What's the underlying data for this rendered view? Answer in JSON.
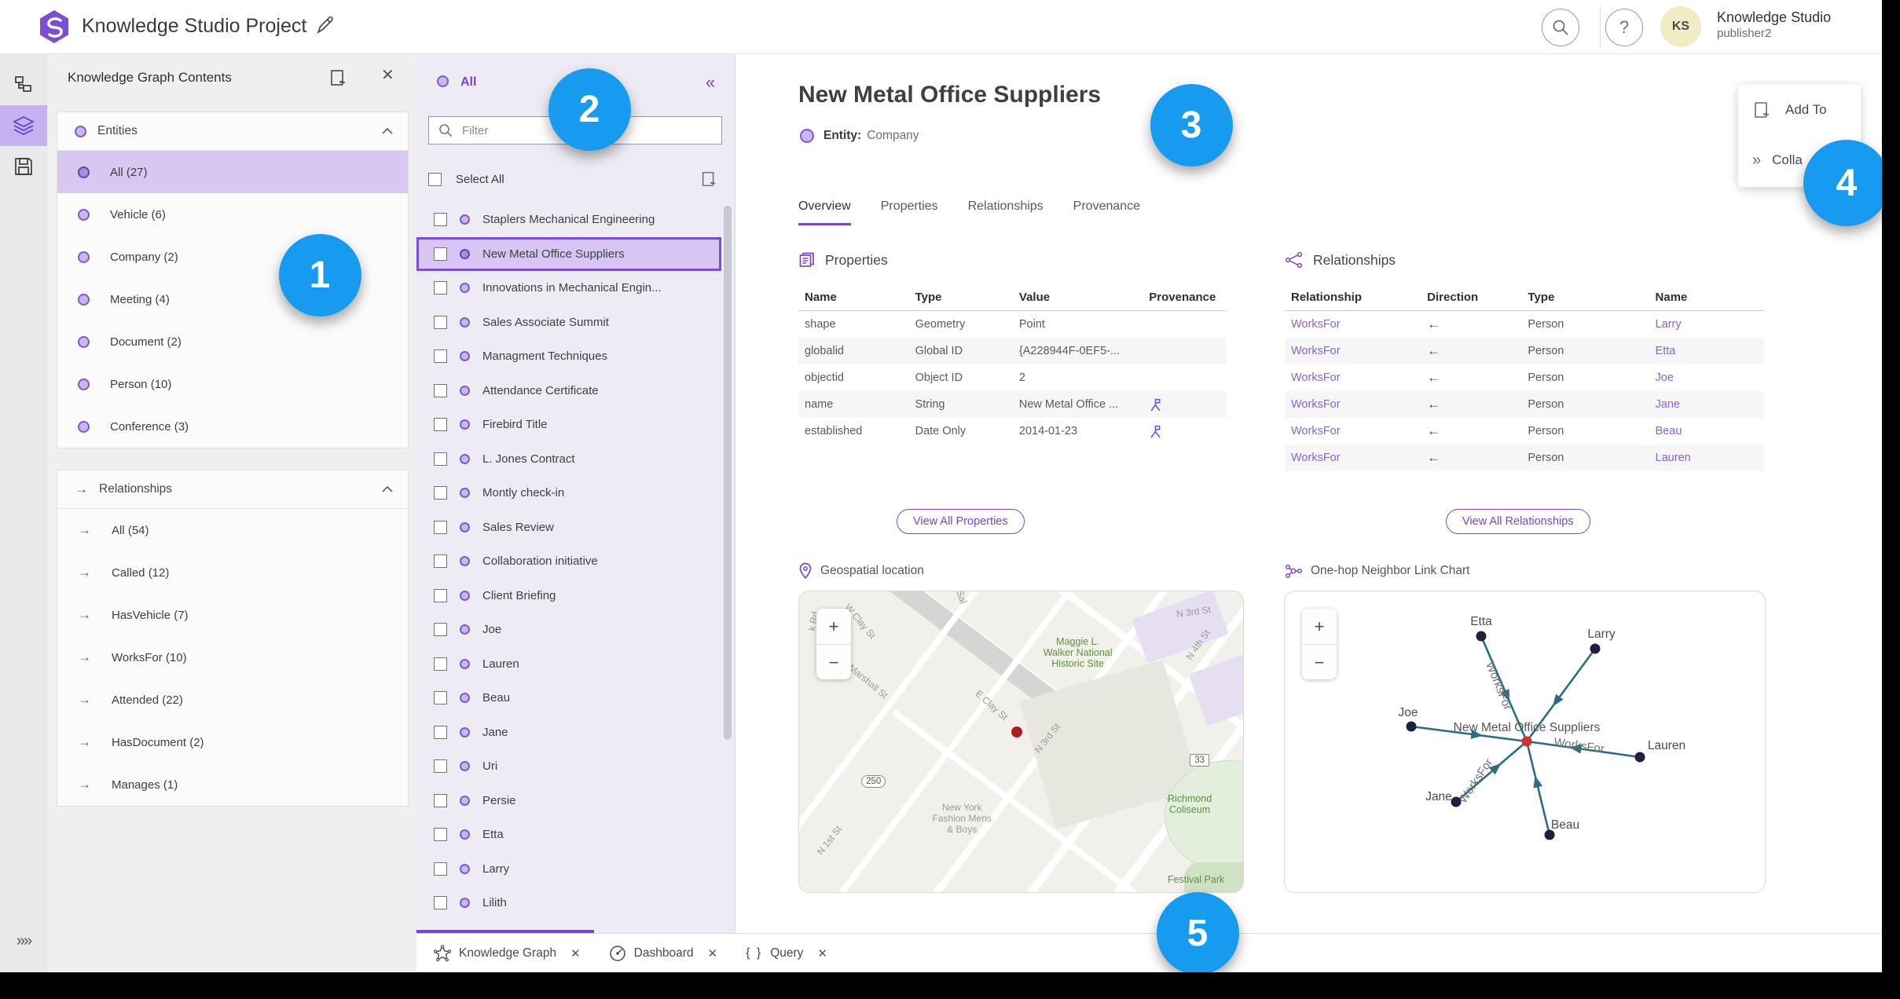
{
  "topbar": {
    "title": "Knowledge Studio Project",
    "user_name": "Knowledge Studio",
    "user_role": "publisher2",
    "avatar_initials": "KS"
  },
  "kg_panel": {
    "title": "Knowledge Graph Contents",
    "entities_label": "Entities",
    "entities": [
      {
        "label": "All (27)",
        "selected": true
      },
      {
        "label": "Vehicle (6)"
      },
      {
        "label": "Company (2)"
      },
      {
        "label": "Meeting (4)"
      },
      {
        "label": "Document (2)"
      },
      {
        "label": "Person (10)"
      },
      {
        "label": "Conference (3)"
      }
    ],
    "relationships_label": "Relationships",
    "relationships": [
      {
        "label": "All (54)"
      },
      {
        "label": "Called (12)"
      },
      {
        "label": "HasVehicle (7)"
      },
      {
        "label": "WorksFor (10)"
      },
      {
        "label": "Attended (22)"
      },
      {
        "label": "HasDocument (2)"
      },
      {
        "label": "Manages (1)"
      }
    ]
  },
  "list_panel": {
    "header": "All",
    "filter_placeholder": "Filter",
    "select_all_label": "Select All",
    "selected_item": "New Metal Office Suppliers",
    "items": [
      "Staplers Mechanical Engineering",
      "New Metal Office Suppliers",
      "Innovations in Mechanical Engin...",
      "Sales Associate Summit",
      "Managment Techniques",
      "Attendance Certificate",
      "Firebird Title",
      "L. Jones Contract",
      "Montly check-in",
      "Sales Review",
      "Collaboration initiative",
      "Client Briefing",
      "Joe",
      "Lauren",
      "Beau",
      "Jane",
      "Uri",
      "Persie",
      "Etta",
      "Larry",
      "Lilith"
    ]
  },
  "detail": {
    "title": "New Metal Office Suppliers",
    "entity_label": "Entity:",
    "entity_type": "Company",
    "tabs": [
      "Overview",
      "Properties",
      "Relationships",
      "Provenance"
    ],
    "active_tab": "Overview",
    "properties": {
      "heading": "Properties",
      "columns": [
        "Name",
        "Type",
        "Value",
        "Provenance"
      ],
      "rows": [
        {
          "name": "shape",
          "type": "Geometry",
          "value": "Point",
          "provenance": false
        },
        {
          "name": "globalid",
          "type": "Global ID",
          "value": "{A228944F-0EF5-...",
          "provenance": false
        },
        {
          "name": "objectid",
          "type": "Object ID",
          "value": "2",
          "provenance": false
        },
        {
          "name": "name",
          "type": "String",
          "value": "New Metal Office ...",
          "provenance": true
        },
        {
          "name": "established",
          "type": "Date Only",
          "value": "2014-01-23",
          "provenance": true
        }
      ],
      "view_all": "View All Properties"
    },
    "relationships": {
      "heading": "Relationships",
      "columns": [
        "Relationship",
        "Direction",
        "Type",
        "Name"
      ],
      "rows": [
        {
          "relationship": "WorksFor",
          "direction": "←",
          "type": "Person",
          "name": "Larry"
        },
        {
          "relationship": "WorksFor",
          "direction": "←",
          "type": "Person",
          "name": "Etta"
        },
        {
          "relationship": "WorksFor",
          "direction": "←",
          "type": "Person",
          "name": "Joe"
        },
        {
          "relationship": "WorksFor",
          "direction": "←",
          "type": "Person",
          "name": "Jane"
        },
        {
          "relationship": "WorksFor",
          "direction": "←",
          "type": "Person",
          "name": "Beau"
        },
        {
          "relationship": "WorksFor",
          "direction": "←",
          "type": "Person",
          "name": "Lauren"
        }
      ],
      "view_all": "View All Relationships"
    },
    "geo": {
      "heading": "Geospatial location",
      "labels": [
        {
          "text": "k Rd",
          "kind": "street"
        },
        {
          "text": "W Clay St",
          "kind": "street"
        },
        {
          "text": "Sal",
          "kind": "street"
        },
        {
          "text": "N 3rd St",
          "kind": "street"
        },
        {
          "text": "Maggie L.\nWalker National\nHistoric Site",
          "kind": "green"
        },
        {
          "text": "N 4th St",
          "kind": "street"
        },
        {
          "text": "W Marshall St",
          "kind": "street"
        },
        {
          "text": "E Clay St",
          "kind": "street"
        },
        {
          "text": "250",
          "kind": "shield-oval"
        },
        {
          "text": "New York\nFashion Mens\n& Boys",
          "kind": "place"
        },
        {
          "text": "N 3rd St",
          "kind": "street"
        },
        {
          "text": "33",
          "kind": "shield-square"
        },
        {
          "text": "Richmond\nColiseum",
          "kind": "green"
        },
        {
          "text": "N 1st St",
          "kind": "street"
        },
        {
          "text": "Festival Park",
          "kind": "green"
        }
      ]
    },
    "link_chart": {
      "heading": "One-hop Neighbor Link Chart",
      "center_label": "New Metal Office Suppliers",
      "edge_label": "WorksFor",
      "nodes": [
        "Etta",
        "Larry",
        "Joe",
        "Lauren",
        "Jane",
        "Beau"
      ],
      "edge_color": "#2a6e80",
      "node_color": "#20203e",
      "center_color": "#cf3434"
    }
  },
  "floating_menu": {
    "items": [
      {
        "label": "Add To",
        "icon": "add-to-icon"
      },
      {
        "label": "Colla",
        "icon": "collapse-icon"
      }
    ]
  },
  "bottom_tabs": [
    {
      "label": "Knowledge Graph",
      "icon": "knowledge-graph-icon",
      "active": true
    },
    {
      "label": "Dashboard",
      "icon": "dashboard-icon",
      "active": false
    },
    {
      "label": "Query",
      "icon": "query-icon",
      "active": false
    }
  ],
  "badges": [
    "1",
    "2",
    "3",
    "4",
    "5"
  ],
  "colors": {
    "accent_purple": "#7a45c9",
    "selected_purple_bg": "#d7c6f3",
    "badge_blue": "#169bf0",
    "link_purple": "#8a63cf",
    "edge_teal": "#2a6e80",
    "marker_red": "#b01c24"
  }
}
